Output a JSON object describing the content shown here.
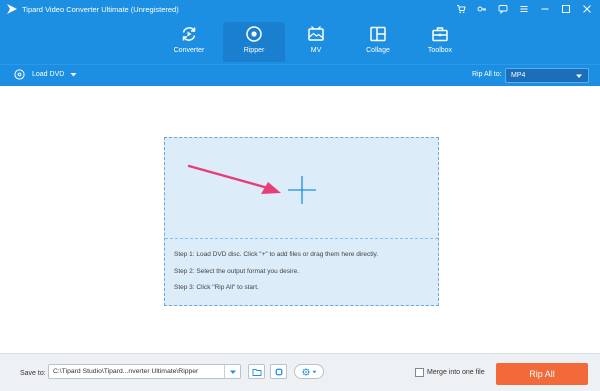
{
  "window": {
    "title": "Tipard Video Converter Ultimate (Unregistered)",
    "controls": [
      {
        "name": "cart-icon"
      },
      {
        "name": "key-icon"
      },
      {
        "name": "chat-icon"
      },
      {
        "name": "menu-icon"
      },
      {
        "name": "minimize-icon"
      },
      {
        "name": "maximize-icon"
      },
      {
        "name": "close-icon"
      }
    ]
  },
  "nav": {
    "tabs": [
      {
        "label": "Converter",
        "icon": "converter-icon",
        "active": false
      },
      {
        "label": "Ripper",
        "icon": "ripper-icon",
        "active": true
      },
      {
        "label": "MV",
        "icon": "mv-icon",
        "active": false
      },
      {
        "label": "Collage",
        "icon": "collage-icon",
        "active": false
      },
      {
        "label": "Toolbox",
        "icon": "toolbox-icon",
        "active": false
      }
    ]
  },
  "subbar": {
    "load_dvd": "Load DVD",
    "rip_all_to_label": "Rip All to:",
    "format_value": "MP4"
  },
  "dropzone": {
    "step1": "Step 1: Load DVD disc. Click \"+\" to add files or drag them here directly.",
    "step2": "Step 2: Select the output format you desire.",
    "step3": "Step 3: Click \"Rip All\" to start."
  },
  "bottom": {
    "save_to_label": "Save to:",
    "save_path": "C:\\Tipard Studio\\Tipard...nverter Ultimate\\Ripper",
    "merge_label": "Merge into one file",
    "merge_checked": false,
    "rip_all_button": "Rip All"
  },
  "colors": {
    "header_blue": "#1d8fe3",
    "active_tab": "#1a7fcf",
    "dropzone_bg": "#dcecf8",
    "arrow_pink": "#e83e78",
    "rip_all_orange": "#f26a3a"
  }
}
